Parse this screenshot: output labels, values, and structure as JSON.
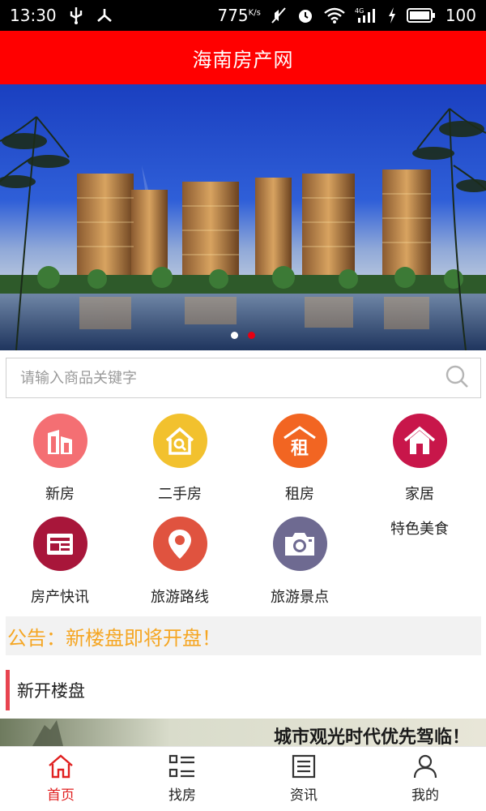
{
  "status_bar": {
    "time": "13:30",
    "net_speed": "775",
    "net_unit": "K/s",
    "battery": "100",
    "icons": [
      "usb-icon",
      "share-icon",
      "muted-icon",
      "alarm-icon",
      "wifi-icon",
      "signal-4g-icon",
      "charging-icon",
      "battery-icon"
    ]
  },
  "header": {
    "title": "海南房产网"
  },
  "banner": {
    "slide_count": 2,
    "active_slide": 2
  },
  "search": {
    "placeholder": "请输入商品关键字"
  },
  "categories": [
    {
      "label": "新房",
      "icon": "building-icon",
      "color": "#f46f73"
    },
    {
      "label": "二手房",
      "icon": "house-search-icon",
      "color": "#f2c12e"
    },
    {
      "label": "租房",
      "icon": "rent-house-icon",
      "color": "#f26522"
    },
    {
      "label": "家居",
      "icon": "home-icon",
      "color": "#c8164a",
      "extra_label": "特色美食"
    },
    {
      "label": "房产快讯",
      "icon": "newspaper-icon",
      "color": "#a8163a"
    },
    {
      "label": "旅游路线",
      "icon": "location-pin-icon",
      "color": "#e0533f"
    },
    {
      "label": "旅游景点",
      "icon": "camera-icon",
      "color": "#6e6a91"
    }
  ],
  "notice": {
    "text": "公告：新楼盘即将开盘！",
    "color": "#f5a623"
  },
  "section": {
    "title": "新开楼盘"
  },
  "promo": {
    "text": "城市观光时代优先驾临！"
  },
  "bottom_nav": [
    {
      "label": "首页",
      "icon": "home-nav-icon",
      "active": true
    },
    {
      "label": "找房",
      "icon": "list-grid-icon",
      "active": false
    },
    {
      "label": "资讯",
      "icon": "news-icon",
      "active": false
    },
    {
      "label": "我的",
      "icon": "user-icon",
      "active": false
    }
  ],
  "colors": {
    "header": "#ff0000",
    "accent": "#e02020",
    "notice": "#f5a623",
    "section_bar": "#e8434f"
  }
}
